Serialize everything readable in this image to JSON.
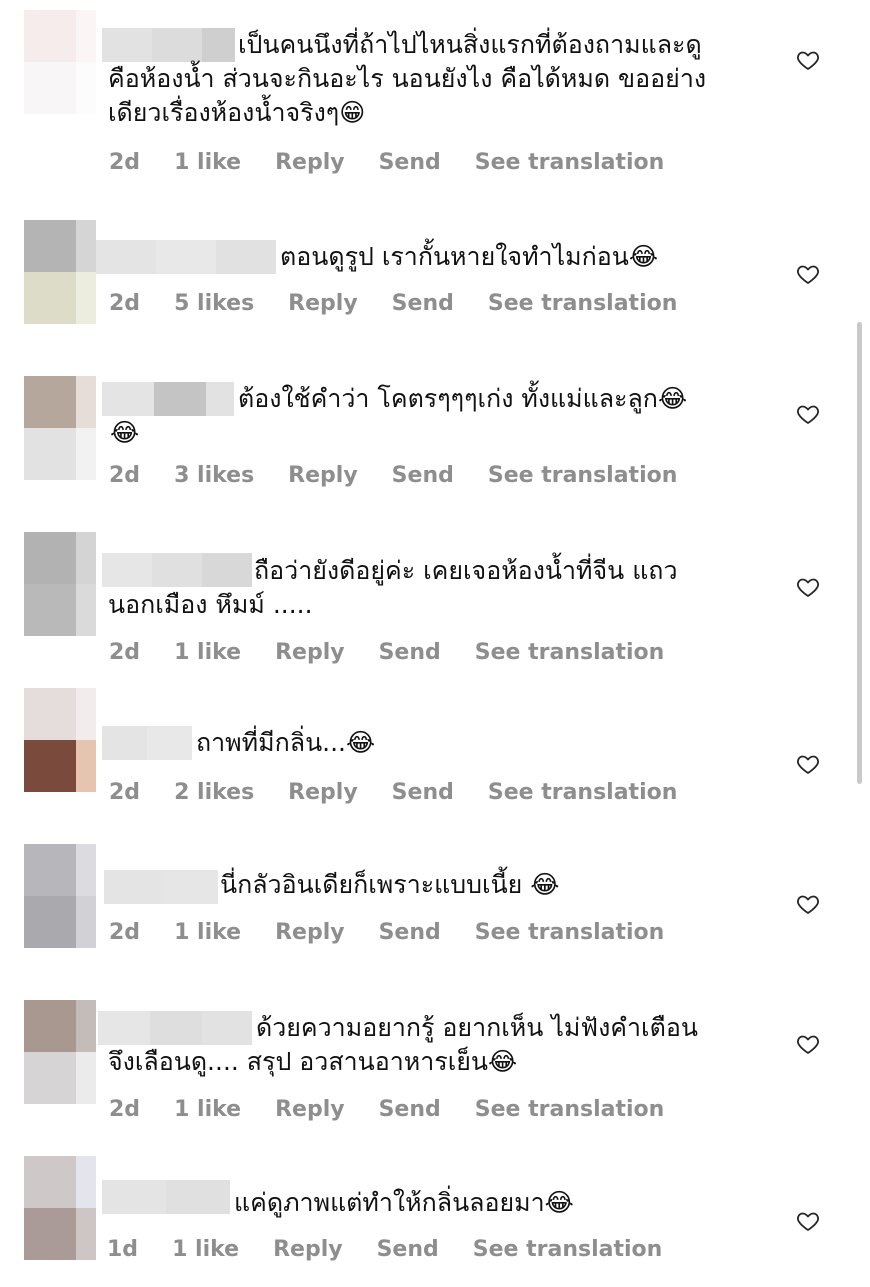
{
  "comments": [
    {
      "text": "เป็นคนนึงที่ถ้าไปไหนสิ่งแรกที่ต้องถามและดู\nคือห้องน้ำ ส่วนจะกินอะไร นอนยังไง คือได้หมด ขออย่าง\nเดียวเรื่องห้องน้ำจริงๆ😁",
      "time": "2d",
      "likes": "1 like",
      "reply": "Reply",
      "send": "Send",
      "translate": "See translation"
    },
    {
      "text": "ตอนดูรูป เรากั้นหายใจทำไมก่อน😂",
      "time": "2d",
      "likes": "5 likes",
      "reply": "Reply",
      "send": "Send",
      "translate": "See translation"
    },
    {
      "text": "ต้องใช้คำว่า โคตรๆๆๆเก่ง ทั้งแม่และลูก😂\n😂",
      "time": "2d",
      "likes": "3 likes",
      "reply": "Reply",
      "send": "Send",
      "translate": "See translation"
    },
    {
      "text": "ถือว่ายังดีอยู่ค่ะ เคยเจอห้องน้ำที่จีน แถว\nนอกเมือง หึมม์ .....",
      "time": "2d",
      "likes": "1 like",
      "reply": "Reply",
      "send": "Send",
      "translate": "See translation"
    },
    {
      "text": "ถาพที่มีกลิ่น...😂",
      "time": "2d",
      "likes": "2 likes",
      "reply": "Reply",
      "send": "Send",
      "translate": "See translation"
    },
    {
      "text": "นี่กลัวอินเดียก็เพราะแบบเนี้ย 😂",
      "time": "2d",
      "likes": "1 like",
      "reply": "Reply",
      "send": "Send",
      "translate": "See translation"
    },
    {
      "text": "ด้วยความอยากรู้ อยากเห็น ไม่ฟังคำเตือน\nจึงเลือนดู.... สรุป อวสานอาหารเย็น😂",
      "time": "2d",
      "likes": "1 like",
      "reply": "Reply",
      "send": "Send",
      "translate": "See translation"
    },
    {
      "text": "แค่ดูภาพแต่ทำให้กลิ่นลอยมา😂",
      "time": "1d",
      "likes": "1 like",
      "reply": "Reply",
      "send": "Send",
      "translate": "See translation"
    }
  ],
  "colors": {
    "meta": "#8e8e8e",
    "text": "#111111",
    "heart": "#262626"
  },
  "icons": {
    "like": "heart-outline-icon"
  }
}
